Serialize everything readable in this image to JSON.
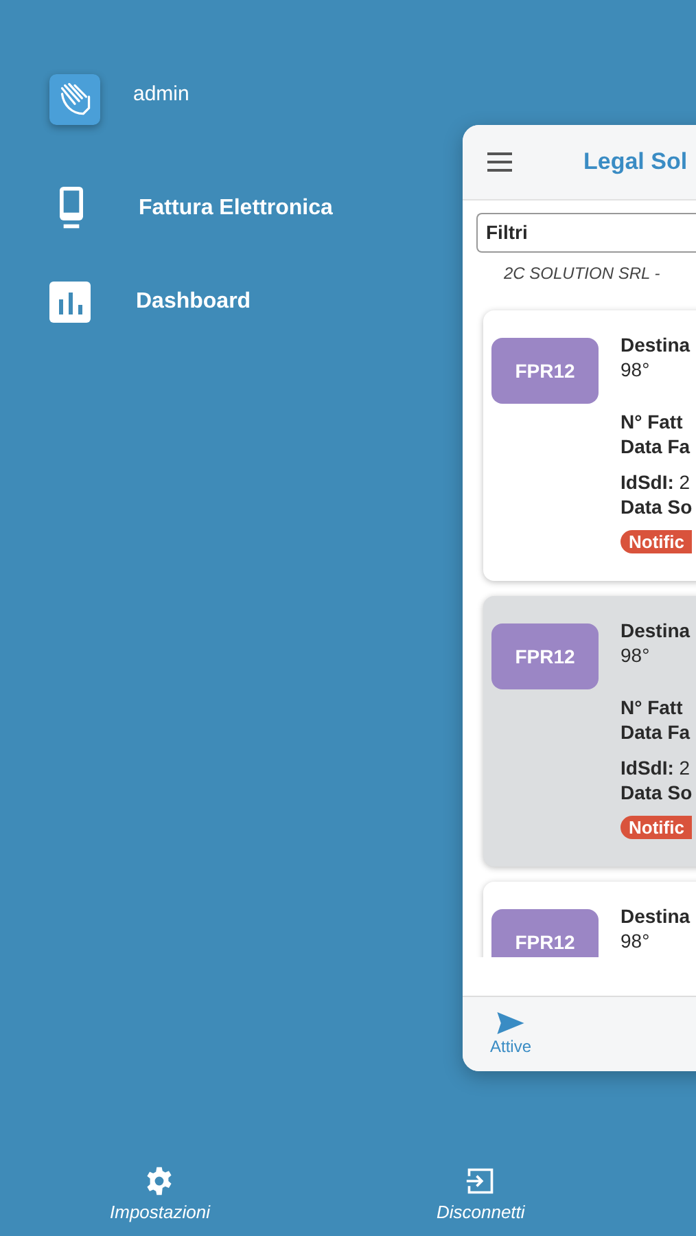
{
  "drawer": {
    "user": "admin",
    "items": [
      {
        "label": "Fattura Elettronica"
      },
      {
        "label": "Dashboard"
      }
    ],
    "footer": [
      {
        "label": "Impostazioni"
      },
      {
        "label": "Disconnetti"
      }
    ]
  },
  "app": {
    "title": "Legal Sol",
    "filter": "Filtri",
    "company": "2C SOLUTION SRL -",
    "cards": [
      {
        "selected": false,
        "badge": "FPR12",
        "head": [
          "Destina",
          "98°"
        ],
        "invoice": [
          "N° Fatt",
          "Data Fa"
        ],
        "sdi": [
          "**IdSdI:** 2",
          "Data So"
        ],
        "status": "Notific"
      },
      {
        "selected": true,
        "badge": "FPR12",
        "head": [
          "Destina",
          "98°"
        ],
        "invoice": [
          "N° Fatt",
          "Data Fa"
        ],
        "sdi": [
          "**IdSdI:** 2",
          "Data So"
        ],
        "status": "Notific"
      },
      {
        "selected": false,
        "badge": "FPR12",
        "head": [
          "Destina",
          "98°"
        ]
      }
    ],
    "nav": [
      {
        "label": "Attive",
        "selected": true
      }
    ]
  }
}
